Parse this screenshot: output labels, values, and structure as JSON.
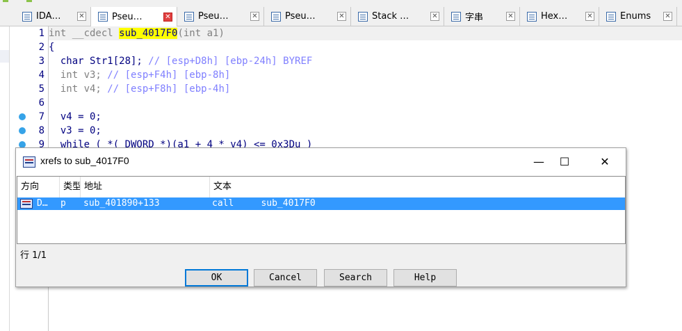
{
  "tabs": [
    {
      "label": "IDA…",
      "icon": "ida-view-icon",
      "active": false
    },
    {
      "label": "Pseu…",
      "icon": "pseudocode-icon",
      "active": true
    },
    {
      "label": "Pseu…",
      "icon": "pseudocode-icon",
      "active": false
    },
    {
      "label": "Pseu…",
      "icon": "pseudocode-icon",
      "active": false
    },
    {
      "label": "Stack  …",
      "icon": "stack-icon",
      "active": false
    },
    {
      "label": "字串",
      "icon": "strings-icon",
      "active": false
    },
    {
      "label": "Hex…",
      "icon": "hex-view-icon",
      "active": false
    },
    {
      "label": "Enums",
      "icon": "enums-icon",
      "active": false
    }
  ],
  "tab_close_glyph": "✕",
  "code": {
    "line_numbers": [
      "1",
      "2",
      "3",
      "4",
      "5",
      "6",
      "7",
      "8",
      "9"
    ],
    "breakpoint_lines": [
      "7",
      "8",
      "9"
    ],
    "lines": [
      {
        "pre": "int __cdecl ",
        "fn": "sub_4017F0",
        "post": "(int a1)"
      },
      {
        "text": "{"
      },
      {
        "text": "  char Str1[28]; ",
        "comment": "// [esp+D8h] [ebp-24h] BYREF"
      },
      {
        "text": "  int v3; ",
        "comment": "// [esp+F4h] [ebp-8h]"
      },
      {
        "text": "  int v4; ",
        "comment": "// [esp+F8h] [ebp-4h]"
      },
      {
        "text": ""
      },
      {
        "text": "  v4 = 0;"
      },
      {
        "text": "  v3 = 0;"
      },
      {
        "text": "  while ( *(_DWORD *)(a1 + 4 * v4) <= 0x3Du )"
      }
    ]
  },
  "dialog": {
    "title": "xrefs to sub_4017F0",
    "minimize_glyph": "—",
    "maximize_glyph": "☐",
    "close_glyph": "✕",
    "columns": [
      "方向",
      "类型",
      "地址",
      "文本"
    ],
    "rows": [
      {
        "direction": "D…",
        "type": "p",
        "address": "sub_401890+133",
        "text": "call     sub_4017F0"
      }
    ],
    "status": "行 1/1",
    "buttons": {
      "ok": "OK",
      "cancel": "Cancel",
      "search": "Search",
      "help": "Help"
    }
  },
  "colors": {
    "selection": "#3399ff",
    "highlight": "#ffff00",
    "breakpoint": "#36a3e8",
    "code_text": "#000080",
    "comment": "#7f7fff"
  }
}
